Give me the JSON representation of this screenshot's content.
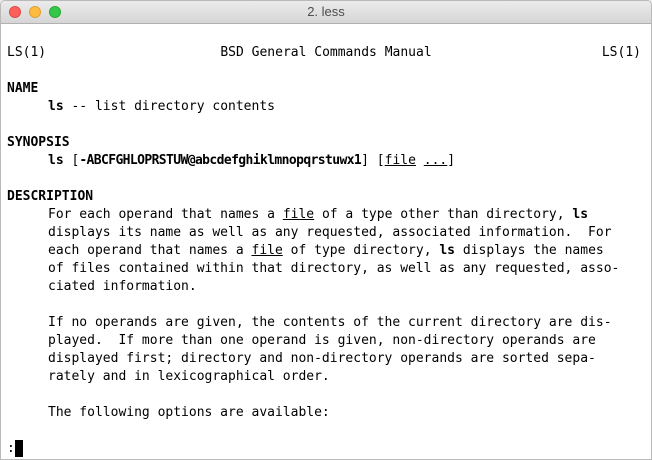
{
  "window": {
    "title": "2. less"
  },
  "header": {
    "left": "LS(1)",
    "center": "BSD General Commands Manual",
    "right": "LS(1)"
  },
  "name_section": {
    "heading": "NAME",
    "command": "ls",
    "description": " -- list directory contents"
  },
  "synopsis_section": {
    "heading": "SYNOPSIS",
    "command": "ls",
    "open_bracket": " [",
    "flags": "-ABCFGHLOPRSTUW@abcdefghiklmnopqrstuwx1",
    "close_open": "] [",
    "file_arg": "file",
    "space": " ",
    "ellipsis": "...",
    "close_bracket": "]"
  },
  "description_section": {
    "heading": "DESCRIPTION",
    "p1": {
      "l1a": "For each operand that names a ",
      "l1_file": "file",
      "l1b": " of a type other than directory, ",
      "l1_ls": "ls",
      "l2": "displays its name as well as any requested, associated information.  For",
      "l3a": "each operand that names a ",
      "l3_file": "file",
      "l3b": " of type directory, ",
      "l3_ls": "ls",
      "l3c": " displays the names",
      "l4": "of files contained within that directory, as well as any requested, asso-",
      "l5": "ciated information."
    },
    "p2": {
      "l1": "If no operands are given, the contents of the current directory are dis-",
      "l2": "played.  If more than one operand is given, non-directory operands are",
      "l3": "displayed first; directory and non-directory operands are sorted sepa-",
      "l4": "rately and in lexicographical order."
    },
    "p3": {
      "l1": "The following options are available:"
    }
  },
  "prompt": {
    "text": ":"
  }
}
